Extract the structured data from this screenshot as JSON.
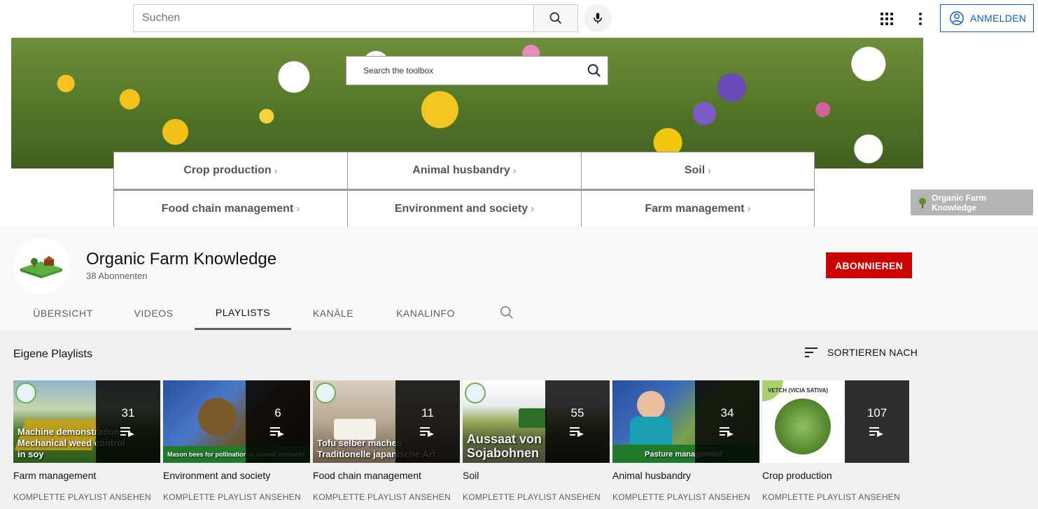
{
  "topbar": {
    "search_placeholder": "Suchen",
    "signin_label": "ANMELDEN"
  },
  "banner": {
    "search_placeholder": "Search the toolbox",
    "categories": [
      "Crop production",
      "Animal husbandry",
      "Soil",
      "Food chain management",
      "Environment and society",
      "Farm management"
    ],
    "chevron": "›",
    "watermark": "Organic Farm Knowledge"
  },
  "channel": {
    "name": "Organic Farm Knowledge",
    "subscribers": "38 Abonnenten",
    "subscribe_label": "ABONNIEREN",
    "tabs": [
      "ÜBERSICHT",
      "VIDEOS",
      "PLAYLISTS",
      "KANÄLE",
      "KANALINFO"
    ],
    "active_tab": "PLAYLISTS"
  },
  "section": {
    "title": "Eigene Playlists",
    "sort_label": "SORTIEREN NACH"
  },
  "playlists": [
    {
      "title": "Farm management",
      "count": "31",
      "thumb_text": "Machine demonstration\nMechanical weed control\nin soy",
      "link": "KOMPLETTE PLAYLIST ANSEHEN"
    },
    {
      "title": "Environment and society",
      "count": "6",
      "thumb_text": "Mason bees for pollination in closed orchards",
      "link": "KOMPLETTE PLAYLIST ANSEHEN"
    },
    {
      "title": "Food chain management",
      "count": "11",
      "thumb_text": "Tofu selber machen\nTraditionelle japanische Art",
      "link": "KOMPLETTE PLAYLIST ANSEHEN"
    },
    {
      "title": "Soil",
      "count": "55",
      "thumb_text": "Aussaat von\nSojabohnen",
      "link": "KOMPLETTE PLAYLIST ANSEHEN"
    },
    {
      "title": "Animal husbandry",
      "count": "34",
      "thumb_text": "Pasture management",
      "link": "KOMPLETTE PLAYLIST ANSEHEN"
    },
    {
      "title": "Crop production",
      "count": "107",
      "thumb_text": "VETCH (VICIA SATIVA)",
      "link": "KOMPLETTE PLAYLIST ANSEHEN"
    }
  ],
  "colors": {
    "subscribe_bg": "#cc0000",
    "signin_blue": "#065fd4",
    "page_bg": "#f9f9f9"
  }
}
